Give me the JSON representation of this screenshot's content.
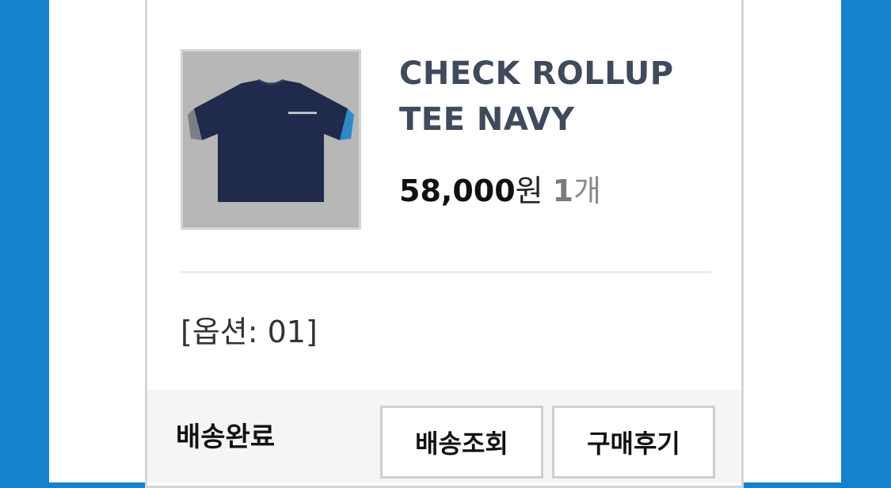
{
  "product": {
    "image_alt": "navy t-shirt",
    "name_line1": "CHECK ROLLUP",
    "name_line2": "TEE NAVY",
    "price": "58,000",
    "price_unit": "원",
    "quantity": "1",
    "quantity_unit": "개",
    "option_text": "[옵션: 01]"
  },
  "order": {
    "status": "배송완료",
    "buttons": {
      "tracking": "배송조회",
      "review": "구매후기"
    }
  },
  "colors": {
    "background": "#1482cc",
    "card_border": "#d6d6d6",
    "product_name": "#3f4a5d",
    "shirt": "#1f2a4d"
  }
}
